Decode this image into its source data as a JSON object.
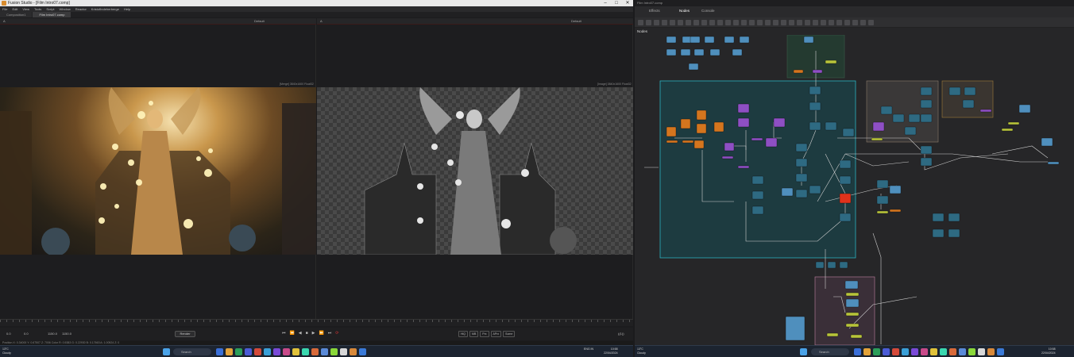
{
  "left_app": {
    "title": "Fusion Studio - [Film Intro07.comp]",
    "menu": [
      "File",
      "Edit",
      "View",
      "Tools",
      "Script",
      "Window",
      "Reactor",
      "KristofIndeherberge",
      "Help"
    ],
    "tabs": [
      "Composition1",
      "Film Intro07.comp"
    ],
    "viewer1": {
      "node_label": "A",
      "lut": "Default",
      "res_label": "[Merge] 3840x1600 Float32"
    },
    "viewer2": {
      "node_label": "A",
      "lut": "Default",
      "res_label": "[Image] 3840x1600 Float32"
    },
    "playback": {
      "start": "0.0",
      "current": "0.0",
      "render_start": "1150.0",
      "end": "1150.0",
      "render_label": "Render",
      "hq_buttons": [
        "HiQ",
        "MB",
        "Prx",
        "APrx",
        "Some"
      ],
      "frame_display": "((1))"
    },
    "status_line": "Position X: 0.34000  Y: 0.67507  Z: 7006   Color R: 0.5383  G: 0.22930  B: 0.17663  A: 1.00524  Z: 0"
  },
  "right_app": {
    "title": "Film Intro07.comp",
    "tabs": [
      "Effects",
      "Nodes",
      "Console"
    ],
    "active_tab": "Nodes",
    "panel_label": "Nodes"
  },
  "taskbar": {
    "weather_temp": "13°C",
    "weather_desc": "Cloudy",
    "search_label": "Search",
    "tray_left": "ENG\nIN",
    "clock_time": "10:58",
    "clock_date": "22/04/2024"
  },
  "colors": {
    "group_teal": "#1d3b40",
    "node_blue": "#4f8fbd",
    "node_teal": "#2e6a82",
    "node_orange": "#d4751e",
    "node_purple": "#8e4fc4",
    "node_red": "#e0321b",
    "node_yellow": "#b8c43a",
    "wire": "#cfcfcf"
  }
}
